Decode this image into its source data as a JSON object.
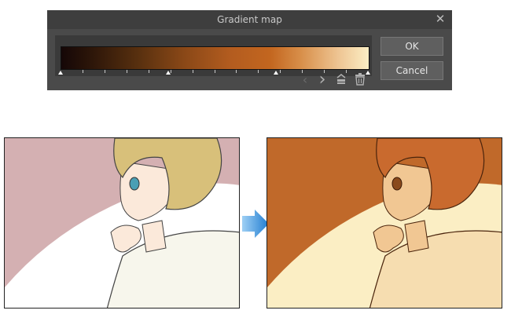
{
  "dialog": {
    "title": "Gradient map",
    "close_icon": "close-icon",
    "ok_label": "OK",
    "cancel_label": "Cancel",
    "gradient": {
      "colors": [
        "#150707",
        "#58300f",
        "#b35c1f",
        "#c3661f",
        "#eec492",
        "#fbeec4"
      ],
      "stop_positions": [
        0,
        0.35,
        0.7,
        1
      ]
    },
    "tools": [
      "previous-icon",
      "next-icon",
      "reverse-icon",
      "trash-icon"
    ]
  },
  "illustration": {
    "before": {
      "background": "#d4b0b2",
      "hair": "#d8c07a",
      "eye": "#4a9fb4",
      "shirt": "#f7f6ec"
    },
    "after": {
      "background": "#c0692a",
      "hair": "#c96a2e",
      "eye": "#8a4a1c",
      "shirt": "#f6ddb0"
    },
    "arrow_color": "#1f7cd0"
  }
}
